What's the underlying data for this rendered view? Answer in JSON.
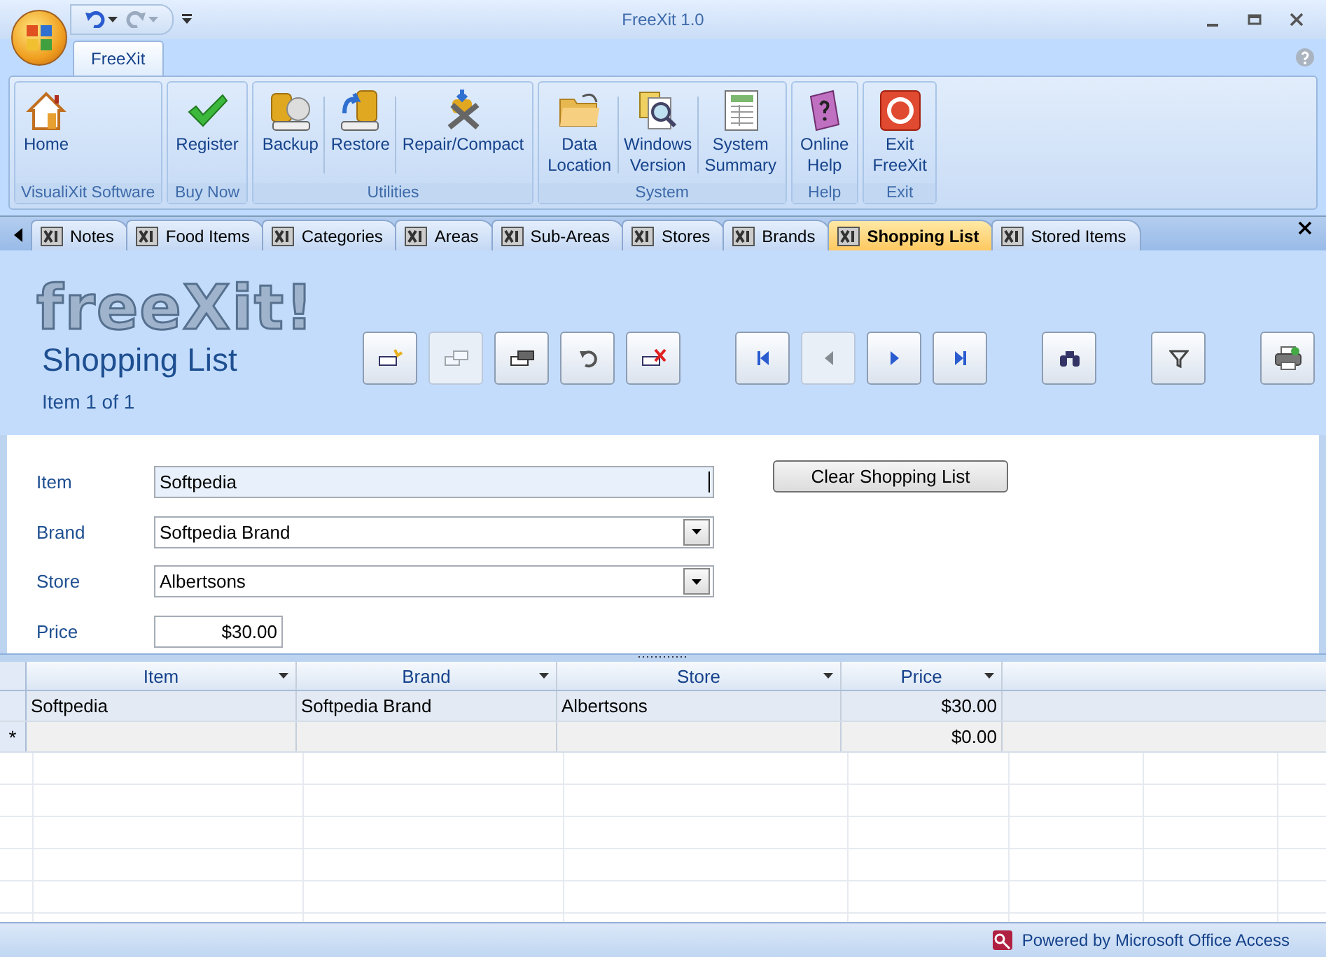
{
  "window": {
    "title": "FreeXit 1.0"
  },
  "ribbon": {
    "tabs": [
      {
        "label": "FreeXit",
        "selected": true
      }
    ],
    "groups": [
      {
        "label": "VisualiXit Software",
        "buttons": [
          {
            "lines": [
              "Home"
            ]
          }
        ]
      },
      {
        "label": "Buy Now",
        "buttons": [
          {
            "lines": [
              "Register"
            ]
          }
        ]
      },
      {
        "label": "Utilities",
        "buttons": [
          {
            "lines": [
              "Backup"
            ]
          },
          {
            "lines": [
              "Restore"
            ]
          },
          {
            "lines": [
              "Repair/Compact"
            ]
          }
        ]
      },
      {
        "label": "System",
        "buttons": [
          {
            "lines": [
              "Data",
              "Location"
            ]
          },
          {
            "lines": [
              "Windows",
              "Version"
            ]
          },
          {
            "lines": [
              "System",
              "Summary"
            ]
          }
        ]
      },
      {
        "label": "Help",
        "buttons": [
          {
            "lines": [
              "Online",
              "Help"
            ]
          }
        ]
      },
      {
        "label": "Exit",
        "buttons": [
          {
            "lines": [
              "Exit",
              "FreeXit"
            ]
          }
        ]
      }
    ]
  },
  "doc_tabs": [
    {
      "label": "Notes",
      "selected": false
    },
    {
      "label": "Food Items",
      "selected": false
    },
    {
      "label": "Categories",
      "selected": false
    },
    {
      "label": "Areas",
      "selected": false
    },
    {
      "label": "Sub-Areas",
      "selected": false
    },
    {
      "label": "Stores",
      "selected": false
    },
    {
      "label": "Brands",
      "selected": false
    },
    {
      "label": "Shopping List",
      "selected": true
    },
    {
      "label": "Stored Items",
      "selected": false
    }
  ],
  "form": {
    "logo": "freeXit!",
    "title": "Shopping List",
    "record": "Item 1 of 1",
    "toolbar": [
      {
        "disabled": false
      },
      {
        "disabled": true
      },
      {
        "disabled": false
      },
      {
        "disabled": false
      },
      {
        "disabled": false
      },
      {
        "disabled": false
      },
      {
        "disabled": true
      },
      {
        "disabled": false
      },
      {
        "disabled": false
      },
      {
        "disabled": false
      },
      {
        "disabled": false
      },
      {
        "disabled": false
      }
    ],
    "fields": [
      {
        "label": "Item",
        "value": "Softpedia",
        "kind": "text",
        "focused": true
      },
      {
        "label": "Brand",
        "value": "Softpedia Brand",
        "kind": "combo",
        "focused": false
      },
      {
        "label": "Store",
        "value": "Albertsons",
        "kind": "combo",
        "focused": false
      },
      {
        "label": "Price",
        "value": "$30.00",
        "kind": "currency",
        "focused": false
      }
    ],
    "clear_button": "Clear Shopping List"
  },
  "datasheet": {
    "columns": [
      "Item",
      "Brand",
      "Store",
      "Price"
    ],
    "rows": [
      {
        "cells": [
          "Softpedia",
          "Softpedia Brand",
          "Albertsons",
          "$30.00"
        ]
      }
    ],
    "new_row": {
      "marker": "*",
      "price": "$0.00"
    }
  },
  "status_bar": {
    "text": "Powered by Microsoft Office Access"
  }
}
